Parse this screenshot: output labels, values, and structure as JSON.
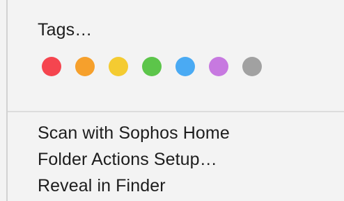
{
  "menu": {
    "tags_label": "Tags…",
    "tag_colors": [
      {
        "name": "red-tag-icon",
        "color": "#f5454f"
      },
      {
        "name": "orange-tag-icon",
        "color": "#f6a02c"
      },
      {
        "name": "yellow-tag-icon",
        "color": "#f4cb31"
      },
      {
        "name": "green-tag-icon",
        "color": "#5cc54a"
      },
      {
        "name": "blue-tag-icon",
        "color": "#4aaaf3"
      },
      {
        "name": "purple-tag-icon",
        "color": "#c779e0"
      },
      {
        "name": "gray-tag-icon",
        "color": "#a1a1a1"
      }
    ],
    "items": [
      {
        "label": "Scan with Sophos Home"
      },
      {
        "label": "Folder Actions Setup…"
      },
      {
        "label": "Reveal in Finder"
      }
    ]
  }
}
